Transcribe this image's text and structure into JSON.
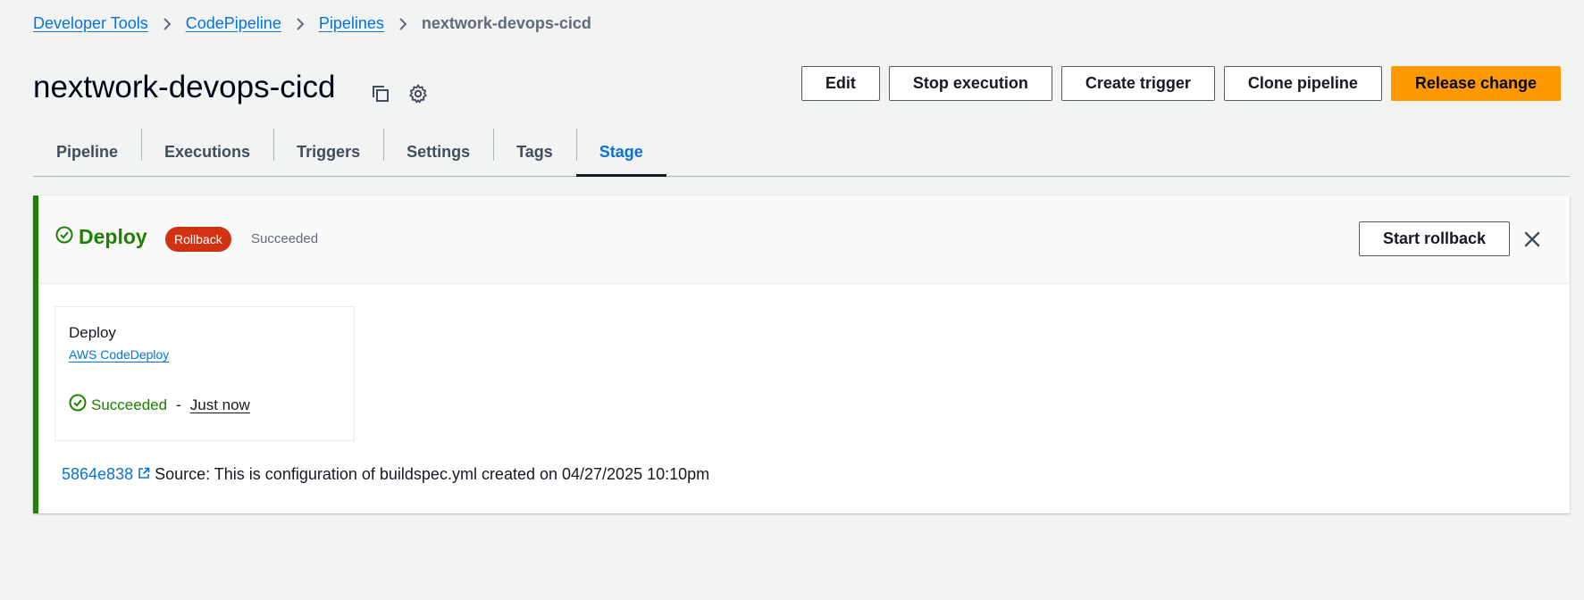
{
  "breadcrumb": {
    "items": [
      "Developer Tools",
      "CodePipeline",
      "Pipelines"
    ],
    "current": "nextwork-devops-cicd"
  },
  "header": {
    "title": "nextwork-devops-cicd",
    "icons": [
      "copy-icon",
      "gear-icon"
    ],
    "actions": {
      "edit": "Edit",
      "stop": "Stop execution",
      "trigger": "Create trigger",
      "clone": "Clone pipeline",
      "release": "Release change"
    }
  },
  "tabs": [
    "Pipeline",
    "Executions",
    "Triggers",
    "Settings",
    "Tags",
    "Stage"
  ],
  "active_tab": "Stage",
  "stage": {
    "name": "Deploy",
    "badge": "Rollback",
    "status": "Succeeded",
    "rollback_button": "Start rollback",
    "action": {
      "name": "Deploy",
      "provider": "AWS CodeDeploy",
      "status": "Succeeded",
      "separator": "-",
      "time": "Just now"
    },
    "source": {
      "commit": "5864e838",
      "message": "Source: This is configuration of buildspec.yml created on 04/27/2025 10:10pm"
    }
  },
  "colors": {
    "accent": "#0972d3",
    "success": "#1d8102",
    "primary": "#ff9900",
    "danger": "#d13212"
  }
}
